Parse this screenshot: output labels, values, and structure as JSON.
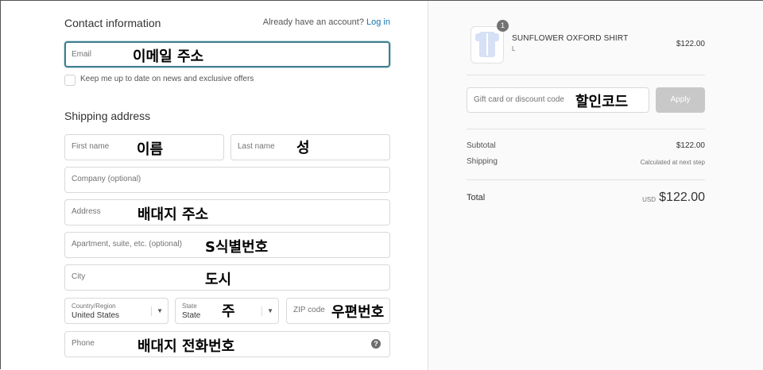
{
  "contact": {
    "title": "Contact information",
    "login_prompt": "Already have an account?",
    "login_link": "Log in",
    "email_placeholder": "Email",
    "email_annotation": "이메일 주소",
    "newsletter_label": "Keep me up to date on news and exclusive offers"
  },
  "shipping": {
    "title": "Shipping address",
    "first_name_placeholder": "First name",
    "first_name_annotation": "이름",
    "last_name_placeholder": "Last name",
    "last_name_annotation": "성",
    "company_placeholder": "Company (optional)",
    "address_placeholder": "Address",
    "address_annotation": "배대지 주소",
    "apartment_placeholder": "Apartment, suite, etc. (optional)",
    "apartment_annotation": "S식별번호",
    "city_placeholder": "City",
    "city_annotation": "도시",
    "country_label": "Country/Region",
    "country_value": "United States",
    "state_label": "State",
    "state_value": "State",
    "state_annotation": "주",
    "zip_placeholder": "ZIP code",
    "zip_annotation": "우편번호",
    "phone_placeholder": "Phone",
    "phone_annotation": "배대지 전화번호",
    "help_glyph": "?"
  },
  "order": {
    "product_name": "SUNFLOWER OXFORD SHIRT",
    "product_variant": "L",
    "product_price": "$122.00",
    "quantity": "1",
    "discount_placeholder": "Gift card or discount code",
    "discount_annotation": "할인코드",
    "apply_label": "Apply",
    "subtotal_label": "Subtotal",
    "subtotal_value": "$122.00",
    "shipping_label": "Shipping",
    "shipping_value": "Calculated at next step",
    "total_label": "Total",
    "total_currency": "USD",
    "total_value": "$122.00"
  },
  "colors": {
    "link": "#1773b0",
    "focus_border": "#3e7e8c",
    "apply_disabled": "#c8c8c8"
  }
}
